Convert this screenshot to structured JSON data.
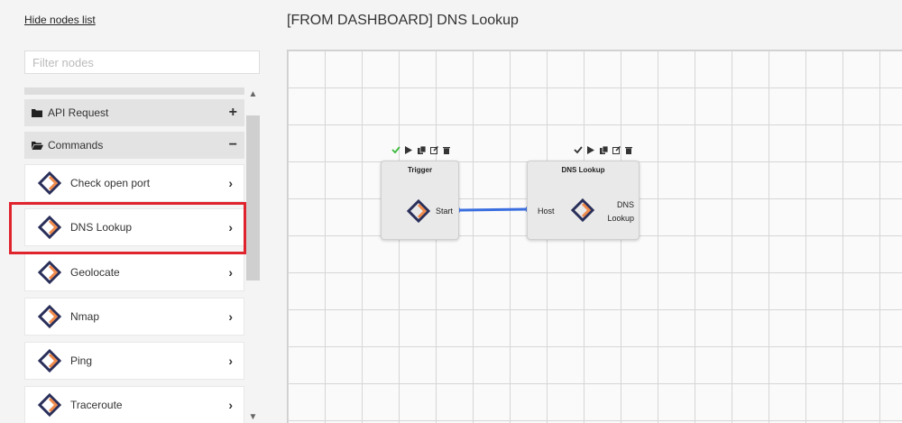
{
  "sidebar": {
    "hide_link": "Hide nodes list",
    "filter_placeholder": "Filter nodes",
    "groups": [
      {
        "label": "API Request",
        "toggle": "+",
        "icon": "folder-icon"
      },
      {
        "label": "Commands",
        "toggle": "−",
        "icon": "folder-open-icon"
      }
    ],
    "items": [
      {
        "label": "Check open port"
      },
      {
        "label": "DNS Lookup"
      },
      {
        "label": "Geolocate"
      },
      {
        "label": "Nmap"
      },
      {
        "label": "Ping"
      },
      {
        "label": "Traceroute"
      }
    ],
    "chevron": "›"
  },
  "main": {
    "title": "[FROM DASHBOARD] DNS Lookup"
  },
  "nodes": {
    "trigger": {
      "title": "Trigger",
      "output": "Start"
    },
    "dns": {
      "title": "DNS Lookup",
      "input": "Host",
      "label_line1": "DNS",
      "label_line2": "Lookup"
    }
  },
  "colors": {
    "accent_orange": "#f08a4b",
    "logo_navy": "#2a2f5a",
    "link_blue": "#3b6fe0",
    "highlight_red": "#e0242e",
    "check_green": "#3cb93c"
  }
}
